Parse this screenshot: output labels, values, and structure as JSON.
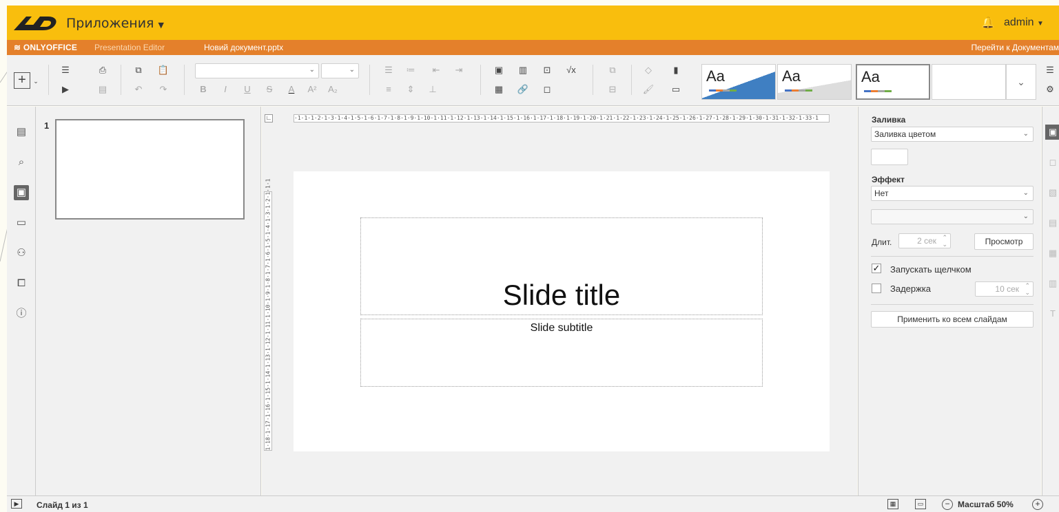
{
  "app_bar": {
    "apps_label": "Приложения",
    "user": "admin"
  },
  "title_bar": {
    "brand": "ONLYOFFICE",
    "editor": "Presentation Editor",
    "document": "Новий документ.pptx",
    "goto_docs": "Перейти к Документам"
  },
  "toolbar": {
    "themes": [
      "Aa",
      "Aa",
      "Aa"
    ]
  },
  "thumbnails": {
    "slide_number": "1"
  },
  "slide": {
    "title": "Slide title",
    "subtitle": "Slide subtitle"
  },
  "rulers": {
    "horizontal": "·1·1·1·2·1·3·1·4·1·5·1·6·1·7·1·8·1·9·1·10·1·11·1·12·1·13·1·14·1·15·1·16·1·17·1·18·1·19·1·20·1·21·1·22·1·23·1·24·1·25·1·26·1·27·1·28·1·29·1·30·1·31·1·32·1·33·1",
    "vertical": "1·18·1·17·1·16·1·15·1·14·1·13·1·12·1·11·1·10·1·9·1·8·1·7·1·6·1·5·1·4·1·3·1·2·1·1·1"
  },
  "settings": {
    "fill_label": "Заливка",
    "fill_value": "Заливка цветом",
    "effect_label": "Эффект",
    "effect_value": "Нет",
    "effect_sub_value": "",
    "duration_label": "Длит.",
    "duration_value": "2 сек",
    "preview_button": "Просмотр",
    "start_on_click_label": "Запускать щелчком",
    "start_on_click_checked": true,
    "delay_label": "Задержка",
    "delay_checked": false,
    "delay_value": "10 сек",
    "apply_all_button": "Применить ко всем слайдам"
  },
  "status_bar": {
    "slide_counter": "Слайд 1 из 1",
    "zoom_label": "Масштаб 50%"
  },
  "colors": {
    "app_bar": "#f9be0d",
    "title_bar": "#e4802b",
    "panel": "#f1f1f1"
  }
}
